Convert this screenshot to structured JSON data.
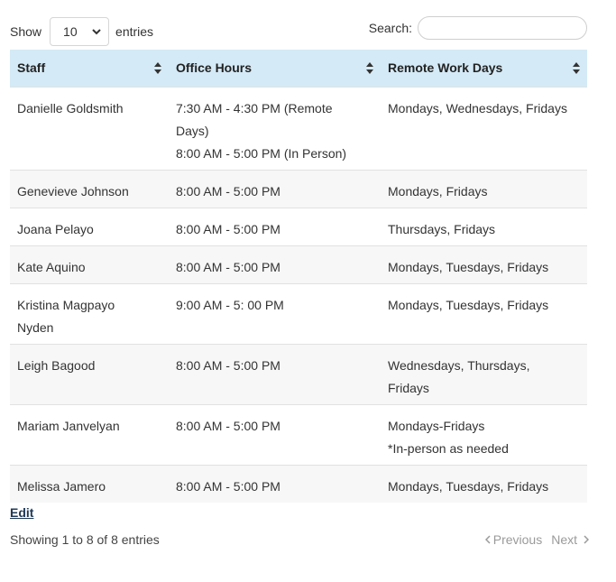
{
  "length_control": {
    "prefix": "Show",
    "selected": "10",
    "suffix": "entries"
  },
  "search": {
    "label": "Search:",
    "value": "",
    "placeholder": ""
  },
  "table": {
    "columns": [
      "Staff",
      "Office Hours",
      "Remote Work Days"
    ],
    "rows": [
      {
        "staff": [
          "Danielle Goldsmith"
        ],
        "hours": [
          "7:30 AM - 4:30 PM (Remote",
          "Days)",
          "8:00 AM - 5:00 PM (In Person)"
        ],
        "remote": [
          "Mondays, Wednesdays, Fridays"
        ]
      },
      {
        "staff": [
          "Genevieve Johnson"
        ],
        "hours": [
          "8:00 AM - 5:00 PM"
        ],
        "remote": [
          "Mondays, Fridays"
        ]
      },
      {
        "staff": [
          "Joana Pelayo"
        ],
        "hours": [
          "8:00 AM - 5:00 PM"
        ],
        "remote": [
          "Thursdays, Fridays"
        ]
      },
      {
        "staff": [
          "Kate Aquino"
        ],
        "hours": [
          "8:00 AM - 5:00 PM"
        ],
        "remote": [
          "Mondays, Tuesdays, Fridays"
        ]
      },
      {
        "staff": [
          "Kristina Magpayo",
          "Nyden"
        ],
        "hours": [
          "9:00 AM - 5: 00 PM"
        ],
        "remote": [
          "Mondays, Tuesdays, Fridays"
        ]
      },
      {
        "staff": [
          "Leigh Bagood"
        ],
        "hours": [
          "8:00 AM - 5:00 PM"
        ],
        "remote": [
          "Wednesdays, Thursdays,",
          "Fridays"
        ]
      },
      {
        "staff": [
          "Mariam Janvelyan"
        ],
        "hours": [
          "8:00 AM - 5:00 PM"
        ],
        "remote": [
          "Mondays-Fridays",
          "*In-person as needed"
        ]
      },
      {
        "staff": [
          "Melissa Jamero"
        ],
        "hours": [
          "8:00 AM - 5:00 PM"
        ],
        "remote": [
          "Mondays, Tuesdays, Fridays"
        ]
      }
    ]
  },
  "edit_link": "Edit",
  "info": "Showing 1 to 8 of 8 entries",
  "pagination": {
    "previous": "Previous",
    "next": "Next"
  },
  "icons": {
    "sort": "sort-both-icon",
    "dropdown": "chevron-down-icon",
    "prev": "chevron-left-icon",
    "next": "chevron-right-icon"
  },
  "colors": {
    "header_bg": "#d4eaf6",
    "stripe_bg": "#f7f7f7",
    "link": "#1f3a56",
    "disabled": "#9a9a9a"
  }
}
